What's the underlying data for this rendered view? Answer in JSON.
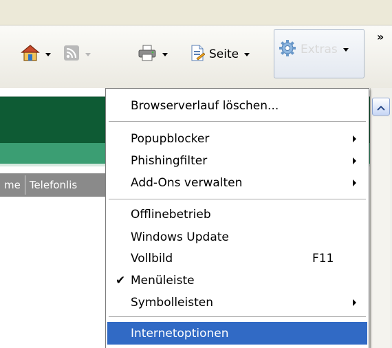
{
  "toolbar": {
    "seite_label": "Seite",
    "extras_label": "Extras"
  },
  "tabs": [
    "me",
    "Telefonlis"
  ],
  "menu": {
    "items": [
      {
        "label": "Browserverlauf löschen..."
      },
      {
        "label": "Popupblocker",
        "submenu": true
      },
      {
        "label": "Phishingfilter",
        "submenu": true
      },
      {
        "label": "Add-Ons verwalten",
        "submenu": true
      },
      {
        "label": "Offlinebetrieb"
      },
      {
        "label": "Windows Update"
      },
      {
        "label": "Vollbild",
        "shortcut": "F11"
      },
      {
        "label": "Menüleiste",
        "checked": true
      },
      {
        "label": "Symbolleisten",
        "submenu": true
      },
      {
        "label": "Internetoptionen",
        "selected": true
      }
    ]
  },
  "colors": {
    "green_header": "#0e5b34",
    "green_band": "#3b9e73",
    "menu_highlight": "#316ac5"
  },
  "icons": [
    "home-icon",
    "feeds-icon",
    "print-icon",
    "page-icon",
    "gear-icon",
    "chevron-more-icon",
    "scroll-up-icon",
    "checkmark-icon"
  ]
}
